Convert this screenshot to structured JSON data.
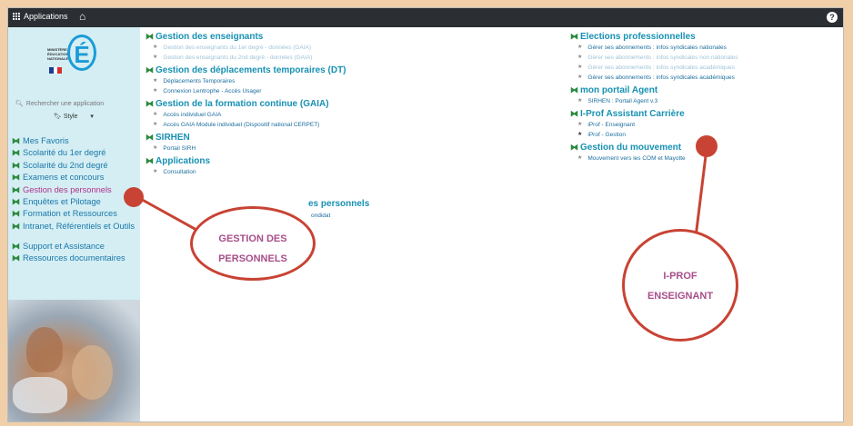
{
  "topbar": {
    "apps_label": "Applications",
    "home_icon": "home-icon",
    "help_icon": "help-icon",
    "help_glyph": "?"
  },
  "sidebar": {
    "logo_text": "MINISTÈRE\nÉDUCATION\nNATIONALE",
    "logo_letter": "É",
    "flag_colors": [
      "#1f3c8f",
      "#ffffff",
      "#d62f2f"
    ],
    "search_placeholder": "Rechercher une application",
    "style_label": "Style",
    "nav": [
      {
        "label": "Mes Favoris"
      },
      {
        "label": "Scolarité du 1er degré"
      },
      {
        "label": "Scolarité du 2nd degré"
      },
      {
        "label": "Examens et concours"
      },
      {
        "label": "Gestion des personnels",
        "active": true
      },
      {
        "label": "Enquêtes et Pilotage"
      },
      {
        "label": "Formation et Ressources"
      },
      {
        "label": "Intranet, Référentiels et Outils",
        "two": true
      },
      {
        "label": "Support et Assistance"
      },
      {
        "label": "Ressources documentaires"
      }
    ]
  },
  "left_sections": [
    {
      "title": "Gestion des enseignants",
      "links": [
        {
          "text": "Gestion des enseignants du 1er degré - données (GAIA)",
          "dim": true
        },
        {
          "text": "Gestion des enseignants du 2nd degré - données (GAIA)",
          "dim": true
        }
      ]
    },
    {
      "title": "Gestion des déplacements temporaires (DT)",
      "links": [
        {
          "text": "Déplacements Temporaires"
        },
        {
          "text": "Connexion Lentrophe - Accès Usager"
        }
      ]
    },
    {
      "title": "Gestion de la formation continue (GAIA)",
      "links": [
        {
          "text": "Accès individuel GAIA"
        },
        {
          "text": "Accès GAIA Module individuel (Dispositif national CERPET)"
        }
      ]
    },
    {
      "title": "SIRHEN",
      "links": [
        {
          "text": "Portail SIRH"
        }
      ]
    },
    {
      "title": "Applications",
      "links": [
        {
          "text": "Consultation"
        }
      ]
    }
  ],
  "left_trailing_title": "es personnels",
  "left_trailing_link": "ondidat",
  "right_sections": [
    {
      "title": "Elections professionnelles",
      "links": [
        {
          "text": "Gérer ses abonnements : infos syndicales nationales"
        },
        {
          "text": "Gérer ses abonnements : infos syndicales non nationales",
          "dim": true
        },
        {
          "text": "Gérer ses abonnements : infos syndicales académiques",
          "dim": true
        },
        {
          "text": "Gérer ses abonnements : infos syndicales académiques"
        }
      ]
    },
    {
      "title": "mon portail Agent",
      "links": [
        {
          "text": "SIRHEN : Portail Agent v.3"
        }
      ]
    },
    {
      "title": "I-Prof Assistant Carrière",
      "links": [
        {
          "text": "iProf - Enseignant"
        },
        {
          "text": "iProf - Gestion",
          "dark": true
        }
      ]
    },
    {
      "title": "Gestion du mouvement",
      "links": [
        {
          "text": "Mouvement vers les COM et Mayotte"
        }
      ]
    }
  ],
  "callouts": {
    "left": {
      "line1": "GESTION DES",
      "line2": "PERSONNELS"
    },
    "right": {
      "line1": "I-PROF",
      "line2": "ENSEIGNANT"
    },
    "color": "#c84334"
  }
}
